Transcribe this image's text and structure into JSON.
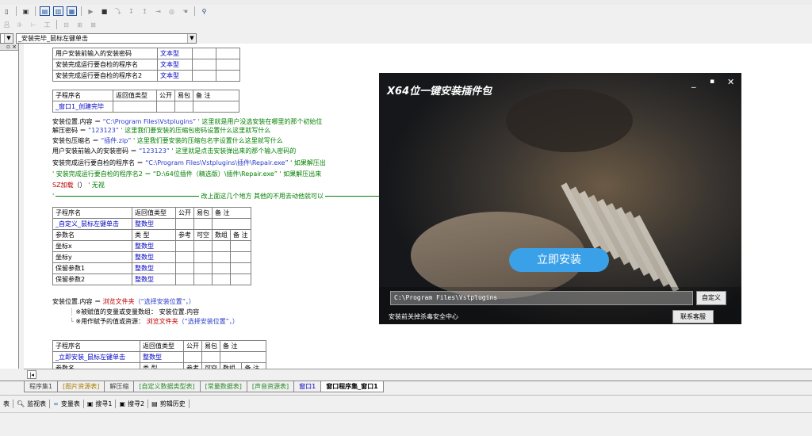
{
  "toolbar": {
    "icons": [
      "window-icon",
      "panel-icon",
      "grid-icon",
      "play-icon",
      "stop-icon",
      "step-icon",
      "step-into-icon",
      "step-out-icon",
      "run-to-icon",
      "breakpoint-icon",
      "find-icon"
    ]
  },
  "combo": {
    "left_value": "",
    "right_value": "_安装完毕_鼠标左键单击"
  },
  "table1": {
    "rows": [
      [
        "用户安装前输入的安装密码",
        "文本型"
      ],
      [
        "安装完成运行要自检的程序名",
        "文本型"
      ],
      [
        "安装完成运行要自检的程序名2",
        "文本型"
      ]
    ]
  },
  "table2": {
    "headers": [
      "子程序名",
      "返回值类型",
      "公开",
      "易包",
      "备 注"
    ],
    "name": "_窗口1_创建完毕"
  },
  "code": {
    "l1": [
      "安装位置.内容 ＝ ",
      "“C:\\Program Files\\Vstplugins”",
      " ' 这里就是用户没选安装在哪里的那个初始位"
    ],
    "l2": [
      "解压密码 ＝ ",
      "“123123”",
      " ' 这里我们要安装的压缩包密码设置什么这里就写什么"
    ],
    "l3": [
      "安装包压缩名 ＝ ",
      "“插件.zip”",
      " ' 这里我们要安装的压缩包名字设置什么这里就写什么"
    ],
    "l4": [
      "用户安装前输入的安装密码 ＝ ",
      "“123123”",
      " ' 这里就是点击安装弹出来的那个输入密码的"
    ],
    "l5": [
      "安装完成运行要自检的程序名 ＝ ",
      "“C:\\Program Files\\Vstplugins\\插件\\Repair.exe”",
      " ' 如果解压出"
    ],
    "l6": "' 安装完成运行要自检的程序名2 ＝ “D:\\64位插件（精选版）\\插件\\Repair.exe” ' 如果解压出来",
    "l7": [
      "SZ加载",
      "（）",
      " ' 无视"
    ],
    "l8": "改上面这几个地方 其他的不用去动他就可以"
  },
  "table3": {
    "headers": [
      "子程序名",
      "返回值类型",
      "公开",
      "易包",
      "备 注"
    ],
    "row": [
      "_自定义_鼠标左键单击",
      "整数型"
    ],
    "param_headers": [
      "参数名",
      "类 型",
      "参考",
      "可空",
      "数组",
      "备 注"
    ],
    "params": [
      [
        "坐标x",
        "整数型"
      ],
      [
        "坐标y",
        "整数型"
      ],
      [
        "保留参数1",
        "整数型"
      ],
      [
        "保留参数2",
        "整数型"
      ]
    ]
  },
  "code2": {
    "l1": [
      "安装位置.内容 ＝ ",
      "浏览文件夹",
      "（“选择安装位置”，）"
    ],
    "l2": "※被赋值的变量或变量数组： 安装位置.内容",
    "l3": [
      "※用作赋予的值或资源： ",
      "浏览文件夹",
      "（“选择安装位置”，）"
    ]
  },
  "table4": {
    "headers": [
      "子程序名",
      "返回值类型",
      "公开",
      "易包",
      "备 注"
    ],
    "row": [
      "_立即安装_鼠标左键单击",
      "整数型"
    ],
    "partial": [
      "参数名",
      "类 型",
      "参考",
      "可空",
      "数组",
      "备 注"
    ]
  },
  "dialog": {
    "title": "X64位一键安装插件包",
    "install_button": "立即安装",
    "path_value": "C:\\Program Files\\Vstplugins",
    "custom_button": "自定义",
    "tip": "安装前关掉杀毒安全中心",
    "contact_button": "联系客服"
  },
  "tabs": [
    "程序集1",
    "[图片资源表]",
    "解压缩",
    "[自定义数据类型表]",
    "[常量数据表]",
    "[声音资源表]",
    "窗口1",
    "窗口程序集_窗口1"
  ],
  "status": [
    "表",
    "监视表",
    "变量表",
    "搜寻1",
    "搜寻2",
    "剪辑历史"
  ],
  "colors": {
    "accent_button": "#3aa0e8",
    "string": "#2a3cc8",
    "comment": "#008000",
    "func": "#c00000"
  }
}
